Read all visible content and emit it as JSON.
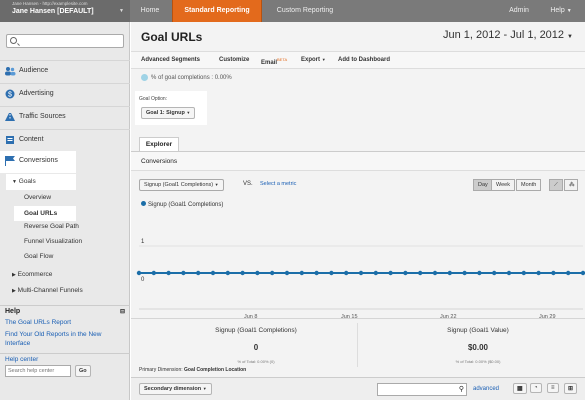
{
  "account": {
    "line1": "Jane Hansen - http://examplesite.com",
    "line2": "Jane Hansen [DEFAULT]"
  },
  "topnav": {
    "home": "Home",
    "standard": "Standard Reporting",
    "custom": "Custom Reporting",
    "admin": "Admin",
    "help": "Help"
  },
  "sidebar": {
    "items": [
      "Audience",
      "Advertising",
      "Traffic Sources",
      "Content",
      "Conversions"
    ],
    "goals": "Goals",
    "sub": [
      "Overview",
      "Goal URLs",
      "Reverse Goal Path",
      "Funnel Visualization",
      "Goal Flow"
    ],
    "ecommerce": "Ecommerce",
    "mcf": "Multi-Channel Funnels",
    "help_title": "Help",
    "help_links": [
      "The Goal URLs Report",
      "Find Your Old Reports in the New Interface"
    ],
    "help_center": "Help center",
    "search_placeholder": "Search help center",
    "go": "Go"
  },
  "main": {
    "title": "Goal URLs",
    "date": "Jun 1, 2012 - Jul 1, 2012",
    "actions": [
      "Advanced Segments",
      "Customize",
      "Email",
      "Export",
      "Add to Dashboard"
    ],
    "beta": "BETA",
    "pct": "% of goal completions : 0.00%",
    "goal_option_label": "Goal Option:",
    "goal_option_value": "Goal 1: Signup",
    "explorer": "Explorer",
    "conversions": "Conversions",
    "metric_select": "Signup (Goal1 Completions)",
    "vs": "VS.",
    "select_metric": "Select a metric",
    "period": [
      "Day",
      "Week",
      "Month"
    ],
    "legend": "Signup (Goal1 Completions)",
    "ytop": "1",
    "ybottom": "0",
    "xlabels": [
      "Jun 8",
      "Jun 15",
      "Jun 22",
      "Jun 29"
    ],
    "m1_label": "Signup (Goal1 Completions)",
    "m1_value": "0",
    "m1_sub": "% of Total: 0.00% (0)",
    "m2_label": "Signup (Goal1 Value)",
    "m2_value": "$0.00",
    "m2_sub": "% of Total: 0.00% ($0.00)",
    "primary_dim": "Primary Dimension:",
    "primary_val": "Goal Completion Location",
    "secondary": "Secondary dimension",
    "advanced": "advanced"
  },
  "colors": {
    "accent": "#e36a1c",
    "series": "#1b6ea8",
    "link": "#1a5fb4"
  }
}
